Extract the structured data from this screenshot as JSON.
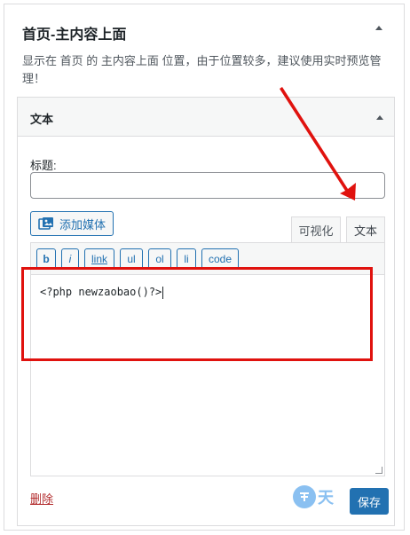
{
  "panel": {
    "title": "首页-主内容上面",
    "description": "显示在 首页 的 主内容上面 位置，由于位置较多，建议使用实时预览管理！"
  },
  "widget": {
    "title": "文本",
    "title_label": "标题:",
    "title_value": "",
    "add_media_label": "添加媒体",
    "tabs": {
      "visual": "可视化",
      "text": "文本"
    },
    "toolbar": [
      "b",
      "i",
      "link",
      "ul",
      "ol",
      "li",
      "code"
    ],
    "content": "<?php newzaobao()?>",
    "delete_label": "删除",
    "save_label": "保存"
  },
  "watermark": {
    "text": "天"
  },
  "colors": {
    "accent": "#2271b1",
    "annotation_red": "#e0120e",
    "delete_red": "#b32d2e"
  }
}
